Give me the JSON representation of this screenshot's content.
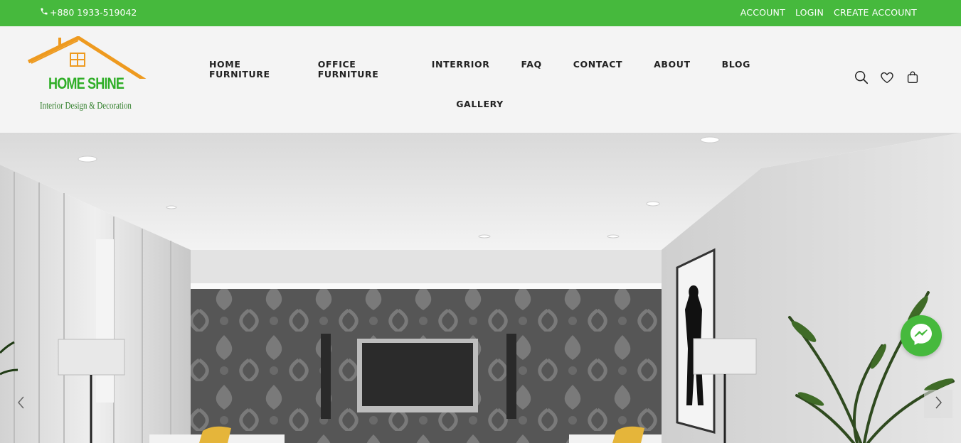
{
  "topbar": {
    "phone": "+880 1933-519042",
    "links": [
      "ACCOUNT",
      "LOGIN",
      "CREATE ACCOUNT"
    ]
  },
  "logo": {
    "brand": "HOME SHINE",
    "tagline": "Interior Design & Decoration"
  },
  "nav": {
    "row1": [
      "HOME FURNITURE",
      "OFFICE FURNITURE",
      "INTERRIOR",
      "FAQ",
      "CONTACT",
      "ABOUT",
      "BLOG"
    ],
    "row2": [
      "GALLERY"
    ]
  },
  "icons": [
    "search-icon",
    "heart-icon",
    "shopping-bag-icon",
    "phone-icon",
    "messenger-icon",
    "chevron-left-icon",
    "chevron-right-icon"
  ],
  "colors": {
    "brand_green": "#46b93d",
    "logo_orange": "#ee9a1f",
    "nav_text": "#222222"
  }
}
